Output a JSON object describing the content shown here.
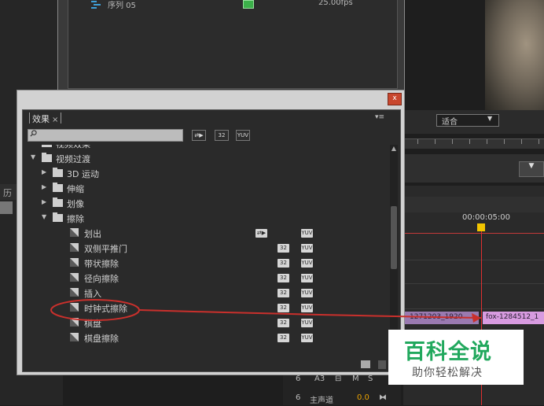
{
  "project": {
    "sequence_name": "序列 05",
    "sequence_fps": "25.00fps"
  },
  "monitor": {
    "fit_label": "适合",
    "dropdown_arrow": "▼",
    "button_glyph": "▼"
  },
  "history_tab": {
    "label": "历"
  },
  "timeline": {
    "timecode": "00:00:05:00",
    "clip_left": "1271203_1920",
    "clip_right": "fox-1284512_1"
  },
  "audio": {
    "rows": [
      {
        "lock": "🔒",
        "name": "A3",
        "m": "M",
        "s": "S"
      },
      {
        "lock": "🔒",
        "name": "主声道",
        "value": "0.0",
        "end": "⧓"
      }
    ]
  },
  "effects_panel": {
    "tab_title": "效果",
    "tab_close": "×",
    "menu_glyph": "▾≡",
    "close_glyph": "x",
    "search_placeholder": "",
    "filter_buttons": [
      "⇄▶",
      "32",
      "YUV"
    ],
    "items": [
      {
        "level": 0,
        "kind": "folder",
        "expanded": true,
        "label": "视频效果",
        "partial": true
      },
      {
        "level": 0,
        "kind": "folder",
        "expanded": true,
        "label": "视频过渡"
      },
      {
        "level": 1,
        "kind": "folder",
        "expanded": false,
        "label": "3D 运动"
      },
      {
        "level": 1,
        "kind": "folder",
        "expanded": false,
        "label": "伸缩"
      },
      {
        "level": 1,
        "kind": "folder",
        "expanded": false,
        "label": "划像"
      },
      {
        "level": 1,
        "kind": "folder",
        "expanded": true,
        "label": "擦除"
      },
      {
        "level": 2,
        "kind": "effect",
        "label": "划出",
        "badges": [
          "acc",
          "",
          "yuv"
        ]
      },
      {
        "level": 2,
        "kind": "effect",
        "label": "双侧平推门",
        "badges": [
          "",
          "32",
          "yuv"
        ]
      },
      {
        "level": 2,
        "kind": "effect",
        "label": "带状擦除",
        "badges": [
          "",
          "32",
          "yuv"
        ]
      },
      {
        "level": 2,
        "kind": "effect",
        "label": "径向擦除",
        "badges": [
          "",
          "32",
          "yuv"
        ]
      },
      {
        "level": 2,
        "kind": "effect",
        "label": "插入",
        "badges": [
          "",
          "32",
          "yuv"
        ]
      },
      {
        "level": 2,
        "kind": "effect",
        "label": "时钟式擦除",
        "badges": [
          "",
          "32",
          "yuv"
        ],
        "highlighted": true
      },
      {
        "level": 2,
        "kind": "effect",
        "label": "棋盘",
        "badges": [
          "",
          "32",
          "yuv"
        ]
      },
      {
        "level": 2,
        "kind": "effect",
        "label": "棋盘擦除",
        "badges": [
          "",
          "32",
          "yuv"
        ]
      }
    ],
    "badge_text": {
      "acc": "⇄▶",
      "32": "32",
      "yuv": "YUV"
    }
  },
  "colors": {
    "annotation": "#c9302c",
    "watermark_green": "#21a85d",
    "clip_purple": "#d89be0",
    "playhead": "#f2c500"
  },
  "watermark": {
    "title": "百科全说",
    "subtitle": "助你轻松解决"
  }
}
